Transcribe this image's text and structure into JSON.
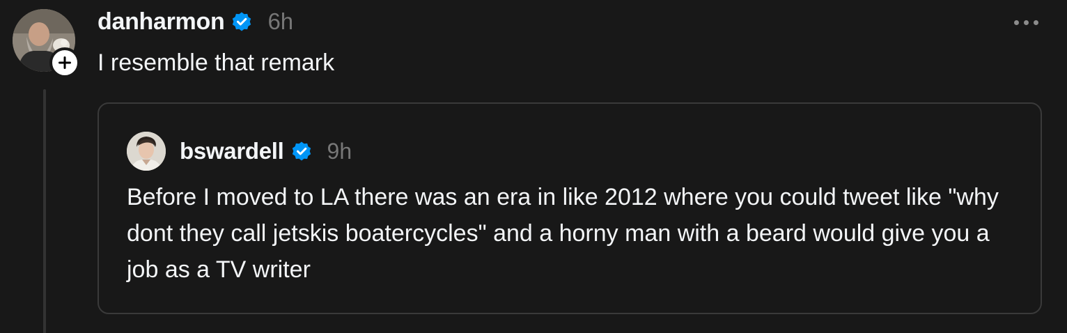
{
  "post": {
    "author": {
      "username": "danharmon",
      "verified": true,
      "avatar_icon": "user-avatar-icon",
      "follow_icon": "plus-icon"
    },
    "timestamp": "6h",
    "text": "I resemble that remark",
    "more_icon": "more-options-icon"
  },
  "quoted_post": {
    "author": {
      "username": "bswardell",
      "verified": true,
      "avatar_icon": "user-avatar-icon"
    },
    "timestamp": "9h",
    "text": "Before I moved to LA there was an era in like 2012 where you could tweet like \"why dont they call jetskis boatercycles\" and a horny man with a beard would give you a job as a TV writer"
  },
  "colors": {
    "background": "#181818",
    "primary_text": "#f3f5f7",
    "secondary_text": "#777777",
    "verified_badge": "#0095f6",
    "card_border": "#3a3a3a",
    "thread_line": "#333333"
  }
}
